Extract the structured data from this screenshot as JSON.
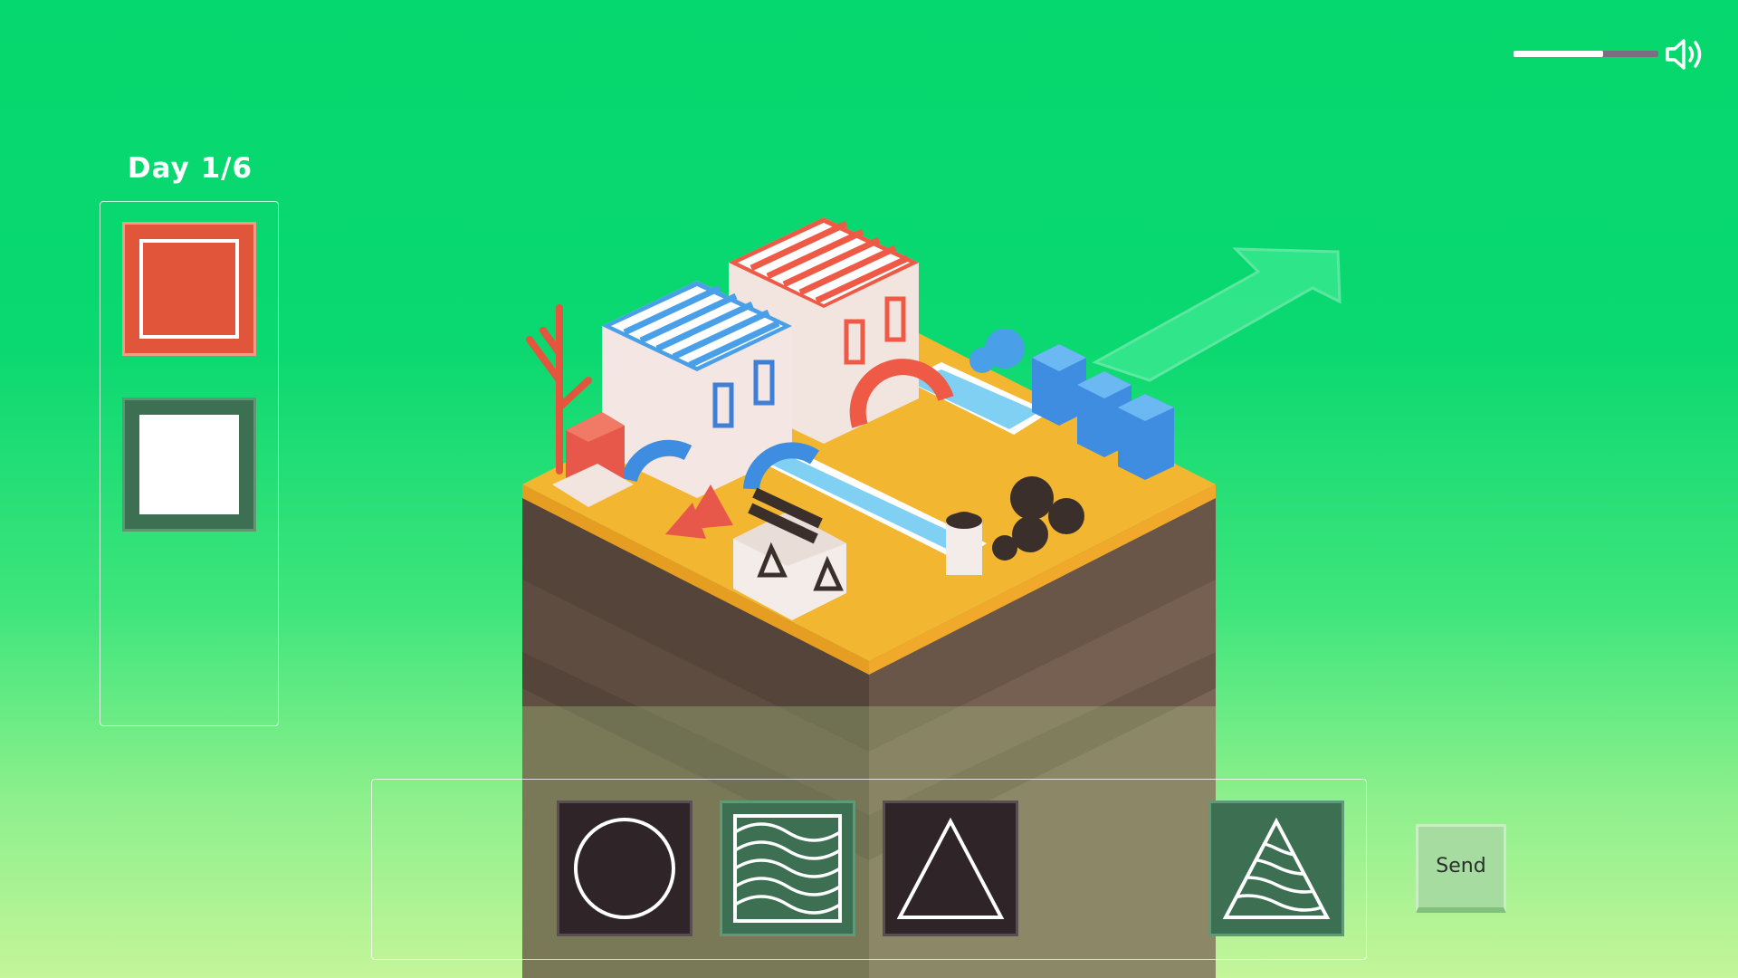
{
  "hud": {
    "day_label": "Day 1/6",
    "send_label": "Send",
    "volume_level": 0.62
  },
  "icons": {
    "volume": "speaker-icon",
    "slot_1": "circle-symbol-icon",
    "slot_2": "waves-symbol-icon",
    "slot_3": "triangle-symbol-icon",
    "result": "wavy-triangle-symbol-icon"
  },
  "colors": {
    "background_top": "#05d86e",
    "background_bottom": "#c4f59a",
    "island_top": "#f3b630",
    "tile_red": "#e1553a",
    "tile_green": "#3d6f52",
    "tile_dark": "#2f2428",
    "send_button": "#a6dca0"
  }
}
